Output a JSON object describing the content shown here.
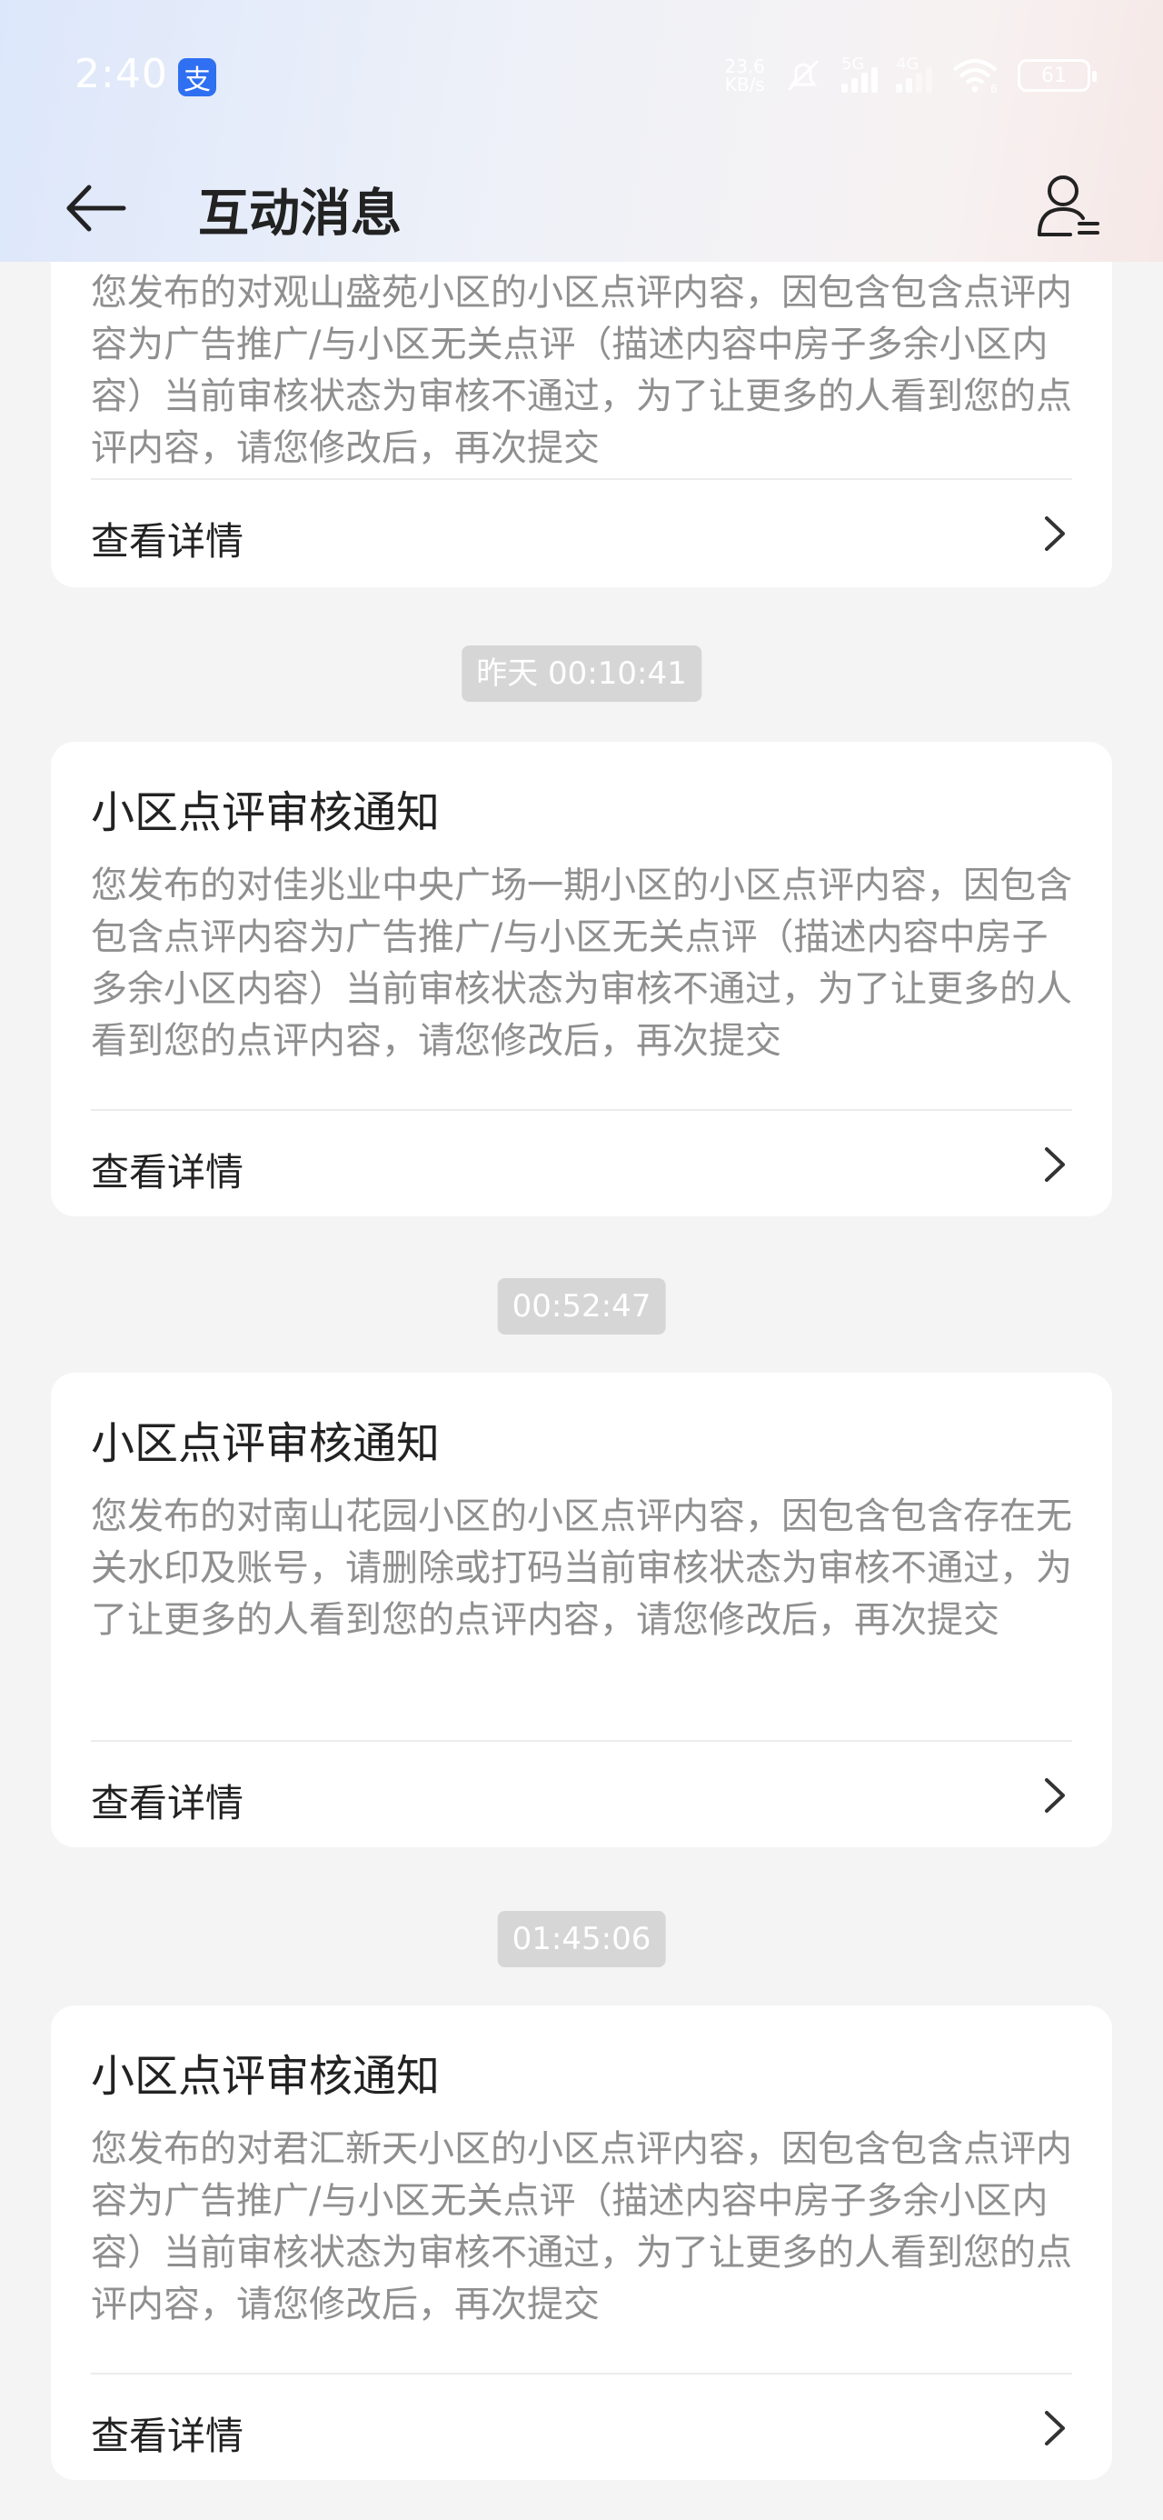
{
  "status_bar": {
    "time": "2:40",
    "alipay_glyph": "支",
    "net_speed_value": "23.6",
    "net_speed_unit": "KB/s",
    "signal1_label": "5G",
    "signal2_label": "4G",
    "wifi_label": "6",
    "battery": "61"
  },
  "header": {
    "title": "互动消息",
    "back_icon": "arrow-left-icon",
    "profile_icon": "user-settings-icon"
  },
  "cards": [
    {
      "title": "",
      "body": "您发布的对观山盛苑小区的小区点评内容，因包含包含点评内容为广告推广/与小区无关点评（描述内容中房子多余小区内容）当前审核状态为审核不通过，为了让更多的人看到您的点评内容，请您修改后，再次提交",
      "detail_label": "查看详情"
    },
    {
      "time": "昨天 00:10:41",
      "title": "小区点评审核通知",
      "body": "您发布的对佳兆业中央广场一期小区的小区点评内容，因包含包含点评内容为广告推广/与小区无关点评（描述内容中房子多余小区内容）当前审核状态为审核不通过，为了让更多的人看到您的点评内容，请您修改后，再次提交",
      "detail_label": "查看详情"
    },
    {
      "time": "00:52:47",
      "title": "小区点评审核通知",
      "body": "您发布的对南山花园小区的小区点评内容，因包含包含存在无关水印及账号，请删除或打码当前审核状态为审核不通过，为了让更多的人看到您的点评内容，请您修改后，再次提交",
      "detail_label": "查看详情"
    },
    {
      "time": "01:45:06",
      "title": "小区点评审核通知",
      "body": "您发布的对君汇新天小区的小区点评内容，因包含包含点评内容为广告推广/与小区无关点评（描述内容中房子多余小区内容）当前审核状态为审核不通过，为了让更多的人看到您的点评内容，请您修改后，再次提交",
      "detail_label": "查看详情"
    }
  ],
  "colors": {
    "card_bg": "#ffffff",
    "page_bg": "#f4f4f4",
    "body_text": "#8f8f8f",
    "time_pill_bg": "#d6d6d6"
  }
}
